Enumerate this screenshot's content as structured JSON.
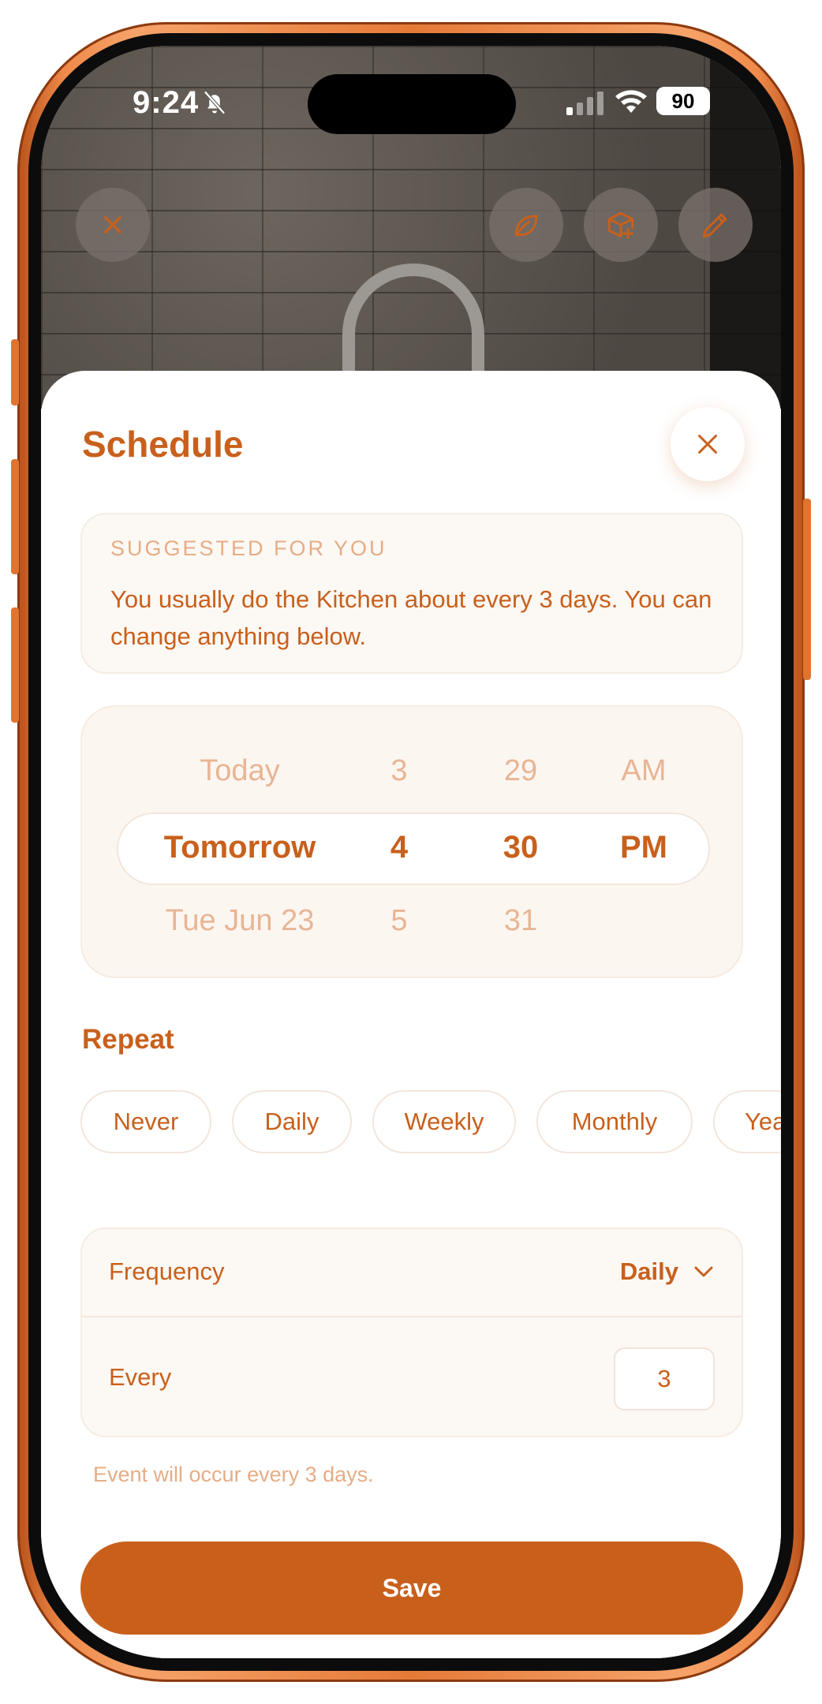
{
  "status_bar": {
    "time": "9:24",
    "battery": "90"
  },
  "top_actions": {
    "icons": [
      "close-icon",
      "leaf-icon",
      "package-plus-icon",
      "pencil-icon"
    ]
  },
  "sheet": {
    "title": "Schedule",
    "close_icon": "close-icon"
  },
  "suggestion": {
    "label": "SUGGESTED FOR YOU",
    "text": "You usually do the Kitchen about every 3 days. You can change anything below."
  },
  "picker": {
    "day": [
      "Today",
      "Tomorrow",
      "Tue Jun 23"
    ],
    "hour": [
      "3",
      "4",
      "5"
    ],
    "minute": [
      "29",
      "30",
      "31"
    ],
    "ampm": [
      "AM",
      "PM",
      ""
    ]
  },
  "repeat": {
    "label": "Repeat",
    "options": [
      "Never",
      "Daily",
      "Weekly",
      "Monthly",
      "Yea"
    ]
  },
  "frequency": {
    "label": "Frequency",
    "value": "Daily",
    "every_label": "Every",
    "every_value": "3"
  },
  "hint": "Event will occur every 3 days.",
  "save_label": "Save",
  "colors": {
    "accent": "#c8601c",
    "muted": "#e6ad86",
    "card_bg": "#fcf8f4",
    "frame": "#e57a38"
  }
}
